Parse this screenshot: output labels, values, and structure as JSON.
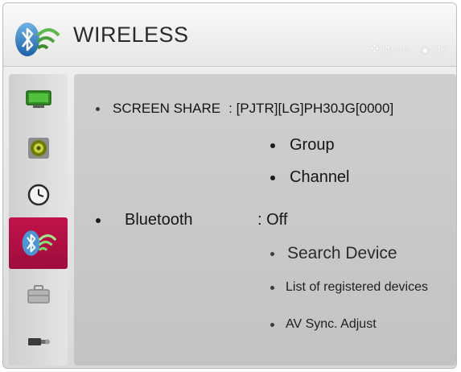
{
  "header": {
    "title": "WIRELESS",
    "hint_move": "Move",
    "hint_ok": "OK"
  },
  "sidebar": {
    "items": [
      {
        "icon": "monitor-icon"
      },
      {
        "icon": "speaker-icon"
      },
      {
        "icon": "clock-icon"
      },
      {
        "icon": "wireless-bluetooth-icon",
        "active": true
      },
      {
        "icon": "toolbox-icon"
      },
      {
        "icon": "input-connector-icon"
      }
    ]
  },
  "menu": {
    "screen_share_label": "SCREEN SHARE",
    "screen_share_value": ": [PJTR][LG]PH30JG[0000]",
    "group_label": "Group",
    "channel_label": "Channel",
    "bluetooth_label": "Bluetooth",
    "bluetooth_value": ": Off",
    "search_device_label": "Search Device",
    "registered_devices_label": "List of registered devices",
    "av_sync_label": "AV Sync. Adjust"
  },
  "colors": {
    "active_highlight": "#b01045",
    "monitor_green": "#39a22a",
    "speaker_olive": "#7a8a1f"
  }
}
